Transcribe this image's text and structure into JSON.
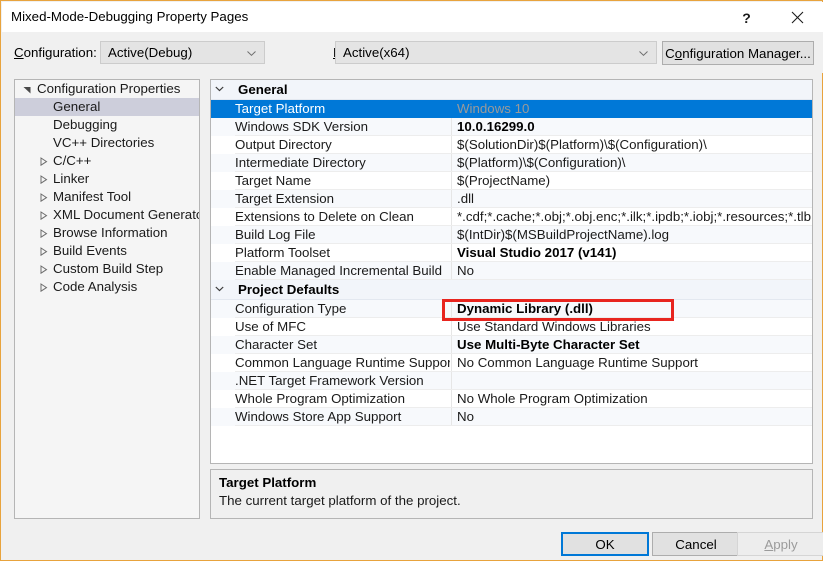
{
  "window": {
    "title": "Mixed-Mode-Debugging Property Pages",
    "help_label": "?",
    "close_label": "close-icon",
    "border_color": "#E8A33D"
  },
  "configbar": {
    "configuration_label": "Configuration:",
    "configuration_value": "Active(Debug)",
    "platform_label": "Platform:",
    "platform_value": "Active(x64)",
    "configuration_manager_label": "Configuration Manager..."
  },
  "tree": {
    "items": [
      {
        "label": "Configuration Properties",
        "level": 0,
        "twisty": "expanded",
        "selected": false
      },
      {
        "label": "General",
        "level": 1,
        "twisty": "none",
        "selected": true
      },
      {
        "label": "Debugging",
        "level": 1,
        "twisty": "none",
        "selected": false
      },
      {
        "label": "VC++ Directories",
        "level": 1,
        "twisty": "none",
        "selected": false
      },
      {
        "label": "C/C++",
        "level": 1,
        "twisty": "collapsed",
        "selected": false
      },
      {
        "label": "Linker",
        "level": 1,
        "twisty": "collapsed",
        "selected": false
      },
      {
        "label": "Manifest Tool",
        "level": 1,
        "twisty": "collapsed",
        "selected": false
      },
      {
        "label": "XML Document Generator",
        "level": 1,
        "twisty": "collapsed",
        "selected": false
      },
      {
        "label": "Browse Information",
        "level": 1,
        "twisty": "collapsed",
        "selected": false
      },
      {
        "label": "Build Events",
        "level": 1,
        "twisty": "collapsed",
        "selected": false
      },
      {
        "label": "Custom Build Step",
        "level": 1,
        "twisty": "collapsed",
        "selected": false
      },
      {
        "label": "Code Analysis",
        "level": 1,
        "twisty": "collapsed",
        "selected": false
      }
    ]
  },
  "grid": {
    "rows": [
      {
        "kind": "section",
        "name": "General"
      },
      {
        "kind": "prop",
        "name": "Target Platform",
        "value": "Windows 10",
        "bold": false,
        "selected": true
      },
      {
        "kind": "prop",
        "name": "Windows SDK Version",
        "value": "10.0.16299.0",
        "bold": true,
        "selected": false
      },
      {
        "kind": "prop",
        "name": "Output Directory",
        "value": "$(SolutionDir)$(Platform)\\$(Configuration)\\",
        "bold": false,
        "selected": false
      },
      {
        "kind": "prop",
        "name": "Intermediate Directory",
        "value": "$(Platform)\\$(Configuration)\\",
        "bold": false,
        "selected": false
      },
      {
        "kind": "prop",
        "name": "Target Name",
        "value": "$(ProjectName)",
        "bold": false,
        "selected": false
      },
      {
        "kind": "prop",
        "name": "Target Extension",
        "value": ".dll",
        "bold": false,
        "selected": false
      },
      {
        "kind": "prop",
        "name": "Extensions to Delete on Clean",
        "value": "*.cdf;*.cache;*.obj;*.obj.enc;*.ilk;*.ipdb;*.iobj;*.resources;*.tlb;*.tli;*.tlh;*",
        "bold": false,
        "selected": false
      },
      {
        "kind": "prop",
        "name": "Build Log File",
        "value": "$(IntDir)$(MSBuildProjectName).log",
        "bold": false,
        "selected": false
      },
      {
        "kind": "prop",
        "name": "Platform Toolset",
        "value": "Visual Studio 2017 (v141)",
        "bold": true,
        "selected": false
      },
      {
        "kind": "prop",
        "name": "Enable Managed Incremental Build",
        "value": "No",
        "bold": false,
        "selected": false
      },
      {
        "kind": "section",
        "name": "Project Defaults"
      },
      {
        "kind": "prop",
        "name": "Configuration Type",
        "value": "Dynamic Library (.dll)",
        "bold": true,
        "selected": false,
        "highlight": true
      },
      {
        "kind": "prop",
        "name": "Use of MFC",
        "value": "Use Standard Windows Libraries",
        "bold": false,
        "selected": false
      },
      {
        "kind": "prop",
        "name": "Character Set",
        "value": "Use Multi-Byte Character Set",
        "bold": true,
        "selected": false
      },
      {
        "kind": "prop",
        "name": "Common Language Runtime Support",
        "value": "No Common Language Runtime Support",
        "bold": false,
        "selected": false
      },
      {
        "kind": "prop",
        "name": ".NET Target Framework Version",
        "value": "",
        "bold": false,
        "selected": false
      },
      {
        "kind": "prop",
        "name": "Whole Program Optimization",
        "value": "No Whole Program Optimization",
        "bold": false,
        "selected": false
      },
      {
        "kind": "prop",
        "name": "Windows Store App Support",
        "value": "No",
        "bold": false,
        "selected": false
      }
    ],
    "highlight_color": "#E8251F",
    "selection_color": "#0078D7"
  },
  "description": {
    "title": "Target Platform",
    "body": "The current target platform of the project."
  },
  "footer": {
    "ok_label": "OK",
    "cancel_label": "Cancel",
    "apply_label": "Apply",
    "apply_accesskey": "A",
    "apply_enabled": false
  }
}
